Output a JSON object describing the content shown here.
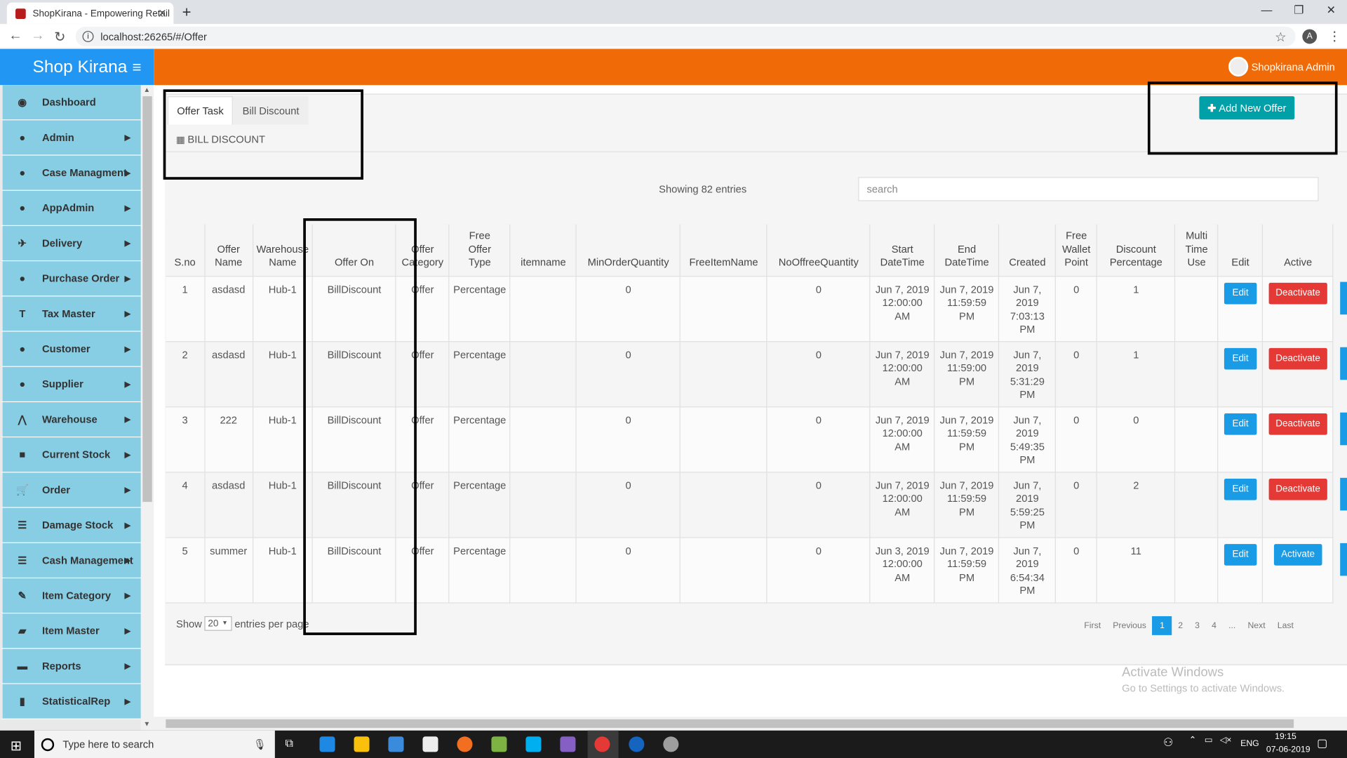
{
  "browser": {
    "tab_title": "ShopKirana - Empowering Retail",
    "url": "localhost:26265/#/Offer",
    "profile_initial": "A"
  },
  "header": {
    "brand": "Shop Kirana",
    "menu_icon": "hamburger-icon",
    "user": "Shopkirana Admin"
  },
  "sidebar": {
    "items": [
      {
        "label": "Dashboard",
        "icon": "dashboard-icon",
        "arrow": false
      },
      {
        "label": "Admin",
        "icon": "user-icon",
        "arrow": true
      },
      {
        "label": "Case Managment",
        "icon": "user-icon",
        "arrow": true
      },
      {
        "label": "AppAdmin",
        "icon": "user-icon",
        "arrow": true
      },
      {
        "label": "Delivery",
        "icon": "plane-icon",
        "arrow": true
      },
      {
        "label": "Purchase Order",
        "icon": "user-icon",
        "arrow": true
      },
      {
        "label": "Tax Master",
        "icon": "text-icon",
        "arrow": true
      },
      {
        "label": "Customer",
        "icon": "user-icon",
        "arrow": true
      },
      {
        "label": "Supplier",
        "icon": "user-icon",
        "arrow": true
      },
      {
        "label": "Warehouse",
        "icon": "road-icon",
        "arrow": true
      },
      {
        "label": "Current Stock",
        "icon": "box-icon",
        "arrow": true
      },
      {
        "label": "Order",
        "icon": "cart-icon",
        "arrow": true
      },
      {
        "label": "Damage Stock",
        "icon": "list-icon",
        "arrow": true
      },
      {
        "label": "Cash Management",
        "icon": "list-icon",
        "arrow": true
      },
      {
        "label": "Item Category",
        "icon": "pencil-icon",
        "arrow": true
      },
      {
        "label": "Item Master",
        "icon": "folder-icon",
        "arrow": true
      },
      {
        "label": "Reports",
        "icon": "briefcase-icon",
        "arrow": true
      },
      {
        "label": "StatisticalRep",
        "icon": "bar-chart-icon",
        "arrow": true
      }
    ]
  },
  "page": {
    "tabs": [
      "Offer Task",
      "Bill Discount"
    ],
    "section_title": "BILL DISCOUNT",
    "add_button": "Add New Offer",
    "showing": "Showing 82 entries",
    "search_placeholder": "search",
    "columns": [
      [
        "S.no"
      ],
      [
        "Offer",
        "Name"
      ],
      [
        "Warehouse",
        "Name"
      ],
      [
        "Offer On"
      ],
      [
        "Offer",
        "Category"
      ],
      [
        "Free",
        "Offer",
        "Type"
      ],
      [
        "itemname"
      ],
      [
        "MinOrderQuantity"
      ],
      [
        "FreeItemName"
      ],
      [
        "NoOffreeQuantity"
      ],
      [
        "Start",
        "DateTime"
      ],
      [
        "End",
        "DateTime"
      ],
      [
        "Created"
      ],
      [
        "Free",
        "Wallet",
        "Point"
      ],
      [
        "Discount",
        "Percentage"
      ],
      [
        "Multi",
        "Time",
        "Use"
      ],
      [
        "Edit"
      ],
      [
        "Active"
      ]
    ],
    "rows": [
      {
        "sno": "1",
        "name": "asdasd",
        "wh": "Hub-1",
        "on": "BillDiscount",
        "cat": "Offer",
        "type": "Percentage",
        "item": "",
        "minq": "0",
        "free": "",
        "noq": "0",
        "start": [
          "Jun 7, 2019",
          "12:00:00",
          "AM"
        ],
        "end": [
          "Jun 7, 2019",
          "11:59:59",
          "PM"
        ],
        "created": [
          "Jun 7,",
          "2019",
          "7:03:13",
          "PM"
        ],
        "wallet": "0",
        "disc": "1",
        "multi": "",
        "edit": "Edit",
        "action": "Deactivate"
      },
      {
        "sno": "2",
        "name": "asdasd",
        "wh": "Hub-1",
        "on": "BillDiscount",
        "cat": "Offer",
        "type": "Percentage",
        "item": "",
        "minq": "0",
        "free": "",
        "noq": "0",
        "start": [
          "Jun 7, 2019",
          "12:00:00",
          "AM"
        ],
        "end": [
          "Jun 7, 2019",
          "11:59:00",
          "PM"
        ],
        "created": [
          "Jun 7,",
          "2019",
          "5:31:29",
          "PM"
        ],
        "wallet": "0",
        "disc": "1",
        "multi": "",
        "edit": "Edit",
        "action": "Deactivate"
      },
      {
        "sno": "3",
        "name": "222",
        "wh": "Hub-1",
        "on": "BillDiscount",
        "cat": "Offer",
        "type": "Percentage",
        "item": "",
        "minq": "0",
        "free": "",
        "noq": "0",
        "start": [
          "Jun 7, 2019",
          "12:00:00",
          "AM"
        ],
        "end": [
          "Jun 7, 2019",
          "11:59:59",
          "PM"
        ],
        "created": [
          "Jun 7,",
          "2019",
          "5:49:35",
          "PM"
        ],
        "wallet": "0",
        "disc": "0",
        "multi": "",
        "edit": "Edit",
        "action": "Deactivate"
      },
      {
        "sno": "4",
        "name": "asdasd",
        "wh": "Hub-1",
        "on": "BillDiscount",
        "cat": "Offer",
        "type": "Percentage",
        "item": "",
        "minq": "0",
        "free": "",
        "noq": "0",
        "start": [
          "Jun 7, 2019",
          "12:00:00",
          "AM"
        ],
        "end": [
          "Jun 7, 2019",
          "11:59:59",
          "PM"
        ],
        "created": [
          "Jun 7,",
          "2019",
          "5:59:25",
          "PM"
        ],
        "wallet": "0",
        "disc": "2",
        "multi": "",
        "edit": "Edit",
        "action": "Deactivate"
      },
      {
        "sno": "5",
        "name": "summer",
        "wh": "Hub-1",
        "on": "BillDiscount",
        "cat": "Offer",
        "type": "Percentage",
        "item": "",
        "minq": "0",
        "free": "",
        "noq": "0",
        "start": [
          "Jun 3, 2019",
          "12:00:00",
          "AM"
        ],
        "end": [
          "Jun 7, 2019",
          "11:59:59",
          "PM"
        ],
        "created": [
          "Jun 7,",
          "2019",
          "6:54:34",
          "PM"
        ],
        "wallet": "0",
        "disc": "11",
        "multi": "",
        "edit": "Edit",
        "action": "Activate"
      }
    ],
    "show_label": "Show",
    "per_page": "20",
    "entries_label": "entries per page",
    "pagination": [
      "First",
      "Previous",
      "1",
      "2",
      "3",
      "4",
      "...",
      "Next",
      "Last"
    ],
    "current_page": "1"
  },
  "watermark": {
    "line1": "Activate Windows",
    "line2": "Go to Settings to activate Windows."
  },
  "taskbar": {
    "search": "Type here to search",
    "lang": "ENG",
    "time": "19:15",
    "date": "07-06-2019"
  }
}
